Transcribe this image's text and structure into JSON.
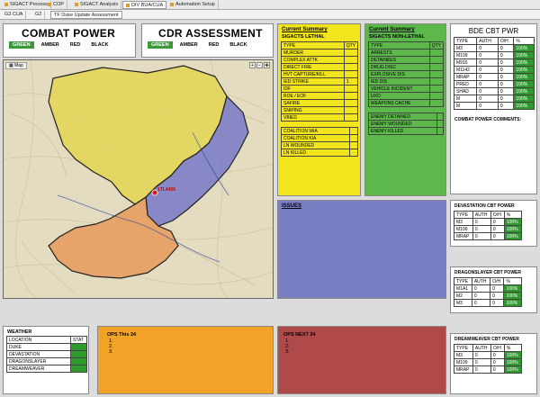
{
  "tabs_top": [
    "SIGACT Process",
    "COP",
    "SIGACT Analysis",
    "DIV BUA/CUA",
    "Automation Setup"
  ],
  "tabs_sub": [
    "G3 CUA",
    "G2",
    "TF Duke Update Assessment"
  ],
  "combat_power": {
    "title": "COMBAT POWER",
    "status": [
      "GREEN",
      "AMBER",
      "RED",
      "BLACK"
    ]
  },
  "cdr_assessment": {
    "title": "CDR ASSESSMENT",
    "status": [
      "GREEN",
      "AMBER",
      "RED",
      "BLACK"
    ]
  },
  "map": {
    "label": "Map",
    "grid": "1TL4406"
  },
  "summary_lethal": {
    "title": "Current Summary",
    "subtitle": "SIGACTS LETHAL",
    "col_type": "TYPE",
    "col_qty": "QTY",
    "rows": [
      [
        "MURDER",
        ""
      ],
      [
        "COMPLEX ATTK",
        ""
      ],
      [
        "DIRECT FIRE",
        ""
      ],
      [
        "HVT CAPTURE/KILL",
        ""
      ],
      [
        "IED STRIKE",
        "1"
      ],
      [
        "IDF",
        ""
      ],
      [
        "ROE / EOF",
        ""
      ],
      [
        "SAFIRE",
        ""
      ],
      [
        "SNIPING",
        ""
      ],
      [
        "VBIED",
        ""
      ]
    ],
    "rows2": [
      [
        "COALITION WIA",
        ""
      ],
      [
        "COALITION KIA",
        ""
      ],
      [
        "LN WOUNDED",
        ""
      ],
      [
        "LN KILLED",
        ""
      ]
    ]
  },
  "summary_nonlethal": {
    "title": "Current Summary",
    "subtitle": "SIGACTS NON-LETHAL",
    "col_type": "TYPE",
    "col_qty": "QTY",
    "rows": [
      [
        "ARRESTS",
        ""
      ],
      [
        "DETAINEES",
        ""
      ],
      [
        "DRUG DISC",
        ""
      ],
      [
        "EXPLOSIVE DIS",
        ""
      ],
      [
        "IED DIS",
        ""
      ],
      [
        "VEHICLE INCIDENT",
        ""
      ],
      [
        "UXO",
        ""
      ],
      [
        "WEAPONS CACHE",
        ""
      ]
    ],
    "rows2": [
      [
        "ENEMY DETAINED",
        ""
      ],
      [
        "ENEMY WOUNDED",
        ""
      ],
      [
        "ENEMY KILLED",
        ""
      ]
    ]
  },
  "issues": {
    "title": "ISSUES"
  },
  "bde": {
    "title": "BDE CBT PWR",
    "cols": [
      "TYPE",
      "AUTH",
      "O/H",
      "%"
    ],
    "rows": [
      [
        "M3",
        "0",
        "0",
        "100%"
      ],
      [
        "M109",
        "0",
        "0",
        "100%"
      ],
      [
        "M915",
        "0",
        "0",
        "100%"
      ],
      [
        "M1142",
        "0",
        "0",
        "100%"
      ],
      [
        "MRAP",
        "0",
        "0",
        "100%"
      ],
      [
        "PRED",
        "0",
        "0",
        "100%"
      ],
      [
        "SHAD",
        "0",
        "0",
        "100%"
      ],
      [
        "M",
        "0",
        "0",
        "100%"
      ],
      [
        "M",
        "0",
        "0",
        "100%"
      ]
    ],
    "comments": "COMBAT POWER COMMENTS:"
  },
  "devastation": {
    "title": "DEVASTATION CBT POWER",
    "cols": [
      "TYPE",
      "AUTH",
      "O/H",
      "%"
    ],
    "rows": [
      [
        "M3",
        "0",
        "0",
        "100%"
      ],
      [
        "M109",
        "0",
        "0",
        "100%"
      ],
      [
        "MRAP",
        "0",
        "0",
        "100%"
      ]
    ]
  },
  "dragonslayer": {
    "title": "DRAGONSLAYER CBT POWER",
    "cols": [
      "TYPE",
      "AUTH",
      "O/H",
      "%"
    ],
    "rows": [
      [
        "M1A1",
        "0",
        "0",
        "100%"
      ],
      [
        "M2",
        "0",
        "0",
        "100%"
      ],
      [
        "M3",
        "0",
        "0",
        "100%"
      ]
    ]
  },
  "dreamweaver": {
    "title": "DREAMWEAVER CBT POWER",
    "cols": [
      "TYPE",
      "AUTH",
      "O/H",
      "%"
    ],
    "rows": [
      [
        "M3",
        "0",
        "0",
        "100%"
      ],
      [
        "M109",
        "0",
        "0",
        "100%"
      ],
      [
        "MRAP",
        "0",
        "0",
        "100%"
      ]
    ]
  },
  "weather": {
    "title": "WEATHER",
    "col_loc": "LOCATION",
    "col_stat": "STAT",
    "rows": [
      "DUKE",
      "DEVASTATION",
      "DRAGONSLAYER",
      "DREAMWEAVER"
    ]
  },
  "ops24": {
    "title": "OPS This 24",
    "items": [
      "1.",
      "2.",
      "3."
    ]
  },
  "opsnext": {
    "title": "OPS NEXT 24",
    "items": [
      "1.",
      "2.",
      "3."
    ]
  },
  "colors": {
    "yellow": "#f2e51c",
    "green": "#5cb84a",
    "purple": "#7a7fc4",
    "orange": "#f0a326",
    "red": "#b04a4a",
    "status_green": "#2e9a2e"
  }
}
